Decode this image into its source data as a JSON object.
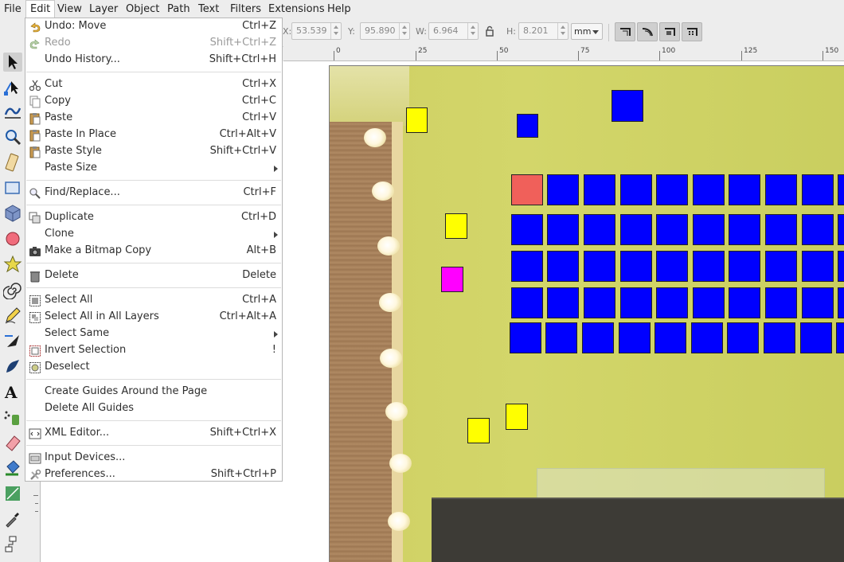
{
  "menubar": {
    "items": [
      "File",
      "Edit",
      "View",
      "Layer",
      "Object",
      "Path",
      "Text",
      "Filters",
      "Extensions",
      "Help"
    ],
    "active": "Edit"
  },
  "controls": {
    "x_label": "X:",
    "x_value": "53.539",
    "y_label": "Y:",
    "y_value": "95.890",
    "w_label": "W:",
    "w_value": "6.964",
    "h_label": "H:",
    "h_value": "8.201",
    "unit": "mm"
  },
  "ruler": {
    "labels": [
      "0",
      "25",
      "50",
      "75",
      "100",
      "125",
      "150"
    ]
  },
  "edit_menu": {
    "items": [
      {
        "label": "Undo: Move",
        "shortcut": "Ctrl+Z",
        "icon": "undo-icon"
      },
      {
        "label": "Redo",
        "shortcut": "Shift+Ctrl+Z",
        "icon": "redo-icon",
        "disabled": true
      },
      {
        "label": "Undo History...",
        "shortcut": "Shift+Ctrl+H",
        "icon": "undo-history-icon"
      },
      {
        "label": "Cut",
        "shortcut": "Ctrl+X",
        "icon": "cut-icon"
      },
      {
        "label": "Copy",
        "shortcut": "Ctrl+C",
        "icon": "copy-icon"
      },
      {
        "label": "Paste",
        "shortcut": "Ctrl+V",
        "icon": "paste-icon"
      },
      {
        "label": "Paste In Place",
        "shortcut": "Ctrl+Alt+V",
        "icon": "paste-in-place-icon"
      },
      {
        "label": "Paste Style",
        "shortcut": "Shift+Ctrl+V",
        "icon": "paste-style-icon"
      },
      {
        "label": "Paste Size",
        "shortcut": "",
        "submenu": true
      },
      {
        "label": "Find/Replace...",
        "shortcut": "Ctrl+F",
        "icon": "find-icon"
      },
      {
        "label": "Duplicate",
        "shortcut": "Ctrl+D",
        "icon": "duplicate-icon"
      },
      {
        "label": "Clone",
        "shortcut": "",
        "submenu": true
      },
      {
        "label": "Make a Bitmap Copy",
        "shortcut": "Alt+B",
        "icon": "bitmap-copy-icon"
      },
      {
        "label": "Delete",
        "shortcut": "Delete",
        "icon": "delete-icon"
      },
      {
        "label": "Select All",
        "shortcut": "Ctrl+A",
        "icon": "select-all-icon"
      },
      {
        "label": "Select All in All Layers",
        "shortcut": "Ctrl+Alt+A",
        "icon": "select-all-layers-icon"
      },
      {
        "label": "Select Same",
        "shortcut": "",
        "submenu": true
      },
      {
        "label": "Invert Selection",
        "shortcut": "!",
        "icon": "invert-selection-icon"
      },
      {
        "label": "Deselect",
        "shortcut": "",
        "icon": "deselect-icon"
      },
      {
        "label": "Create Guides Around the Page",
        "shortcut": ""
      },
      {
        "label": "Delete All Guides",
        "shortcut": ""
      },
      {
        "label": "XML Editor...",
        "shortcut": "Shift+Ctrl+X",
        "icon": "xml-editor-icon"
      },
      {
        "label": "Input Devices...",
        "shortcut": "",
        "icon": "input-devices-icon"
      },
      {
        "label": "Preferences...",
        "shortcut": "Shift+Ctrl+P",
        "icon": "preferences-icon"
      }
    ]
  },
  "colors": {
    "blue_square": "#0000ff",
    "yellow_square": "#ffff00",
    "magenta_square": "#ff00ff",
    "red_square": "#f0605a"
  }
}
